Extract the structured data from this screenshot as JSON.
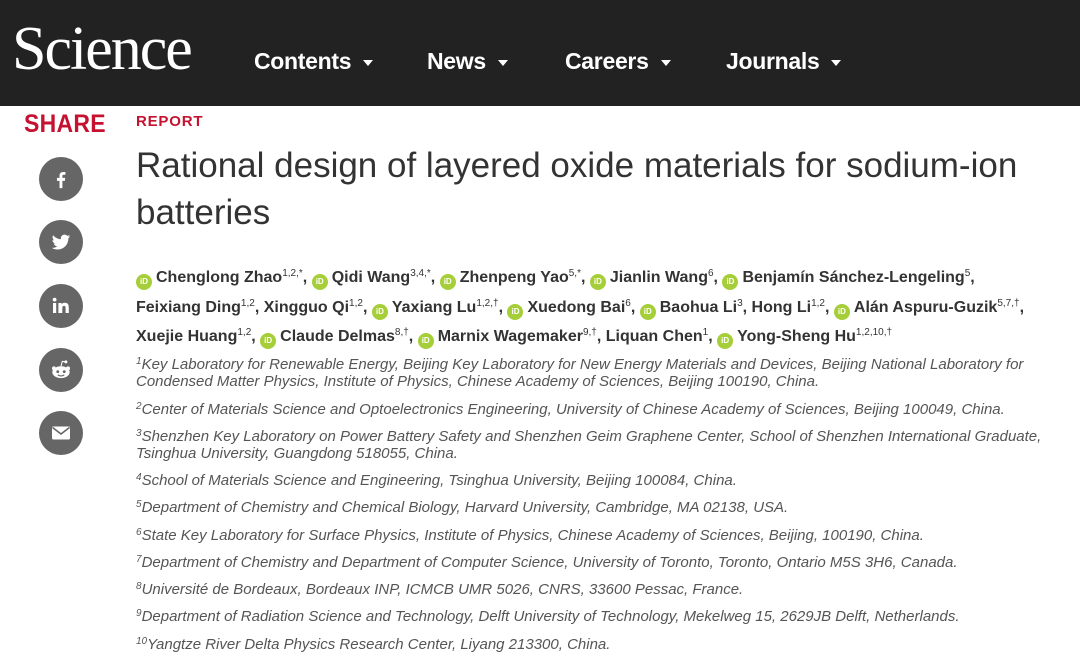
{
  "header": {
    "logo": "Science",
    "nav": [
      {
        "label": "Contents"
      },
      {
        "label": "News"
      },
      {
        "label": "Careers"
      },
      {
        "label": "Journals"
      }
    ]
  },
  "share": {
    "title": "SHARE",
    "buttons": [
      {
        "icon": "facebook-icon"
      },
      {
        "icon": "twitter-icon"
      },
      {
        "icon": "linkedin-icon"
      },
      {
        "icon": "reddit-icon"
      },
      {
        "icon": "email-icon"
      }
    ]
  },
  "article": {
    "type": "REPORT",
    "title": "Rational design of layered oxide materials for sodium-ion batteries",
    "orcid_label": "iD",
    "authors": [
      {
        "name": "Chenglong Zhao",
        "sup": "1,2,*",
        "orcid": true
      },
      {
        "name": "Qidi Wang",
        "sup": "3,4,*",
        "orcid": true
      },
      {
        "name": "Zhenpeng Yao",
        "sup": "5,*",
        "orcid": true
      },
      {
        "name": "Jianlin Wang",
        "sup": "6",
        "orcid": true
      },
      {
        "name": "Benjamín Sánchez-Lengeling",
        "sup": "5",
        "orcid": true
      },
      {
        "name": "Feixiang Ding",
        "sup": "1,2",
        "orcid": false
      },
      {
        "name": "Xingguo Qi",
        "sup": "1,2",
        "orcid": false
      },
      {
        "name": "Yaxiang Lu",
        "sup": "1,2,†",
        "orcid": true
      },
      {
        "name": "Xuedong Bai",
        "sup": "6",
        "orcid": true
      },
      {
        "name": "Baohua Li",
        "sup": "3",
        "orcid": true
      },
      {
        "name": "Hong Li",
        "sup": "1,2",
        "orcid": false
      },
      {
        "name": "Alán Aspuru-Guzik",
        "sup": "5,7,†",
        "orcid": true
      },
      {
        "name": "Xuejie Huang",
        "sup": "1,2",
        "orcid": false
      },
      {
        "name": "Claude Delmas",
        "sup": "8,†",
        "orcid": true
      },
      {
        "name": "Marnix Wagemaker",
        "sup": "9,†",
        "orcid": true
      },
      {
        "name": "Liquan Chen",
        "sup": "1",
        "orcid": false
      },
      {
        "name": "Yong-Sheng Hu",
        "sup": "1,2,10,†",
        "orcid": true
      }
    ],
    "affiliations": [
      {
        "num": "1",
        "text": "Key Laboratory for Renewable Energy, Beijing Key Laboratory for New Energy Materials and Devices, Beijing National Laboratory for Condensed Matter Physics, Institute of Physics, Chinese Academy of Sciences, Beijing 100190, China."
      },
      {
        "num": "2",
        "text": "Center of Materials Science and Optoelectronics Engineering, University of Chinese Academy of Sciences, Beijing 100049, China."
      },
      {
        "num": "3",
        "text": "Shenzhen Key Laboratory on Power Battery Safety and Shenzhen Geim Graphene Center, School of Shenzhen International Graduate, Tsinghua University, Guangdong 518055, China."
      },
      {
        "num": "4",
        "text": "School of Materials Science and Engineering, Tsinghua University, Beijing 100084, China."
      },
      {
        "num": "5",
        "text": "Department of Chemistry and Chemical Biology, Harvard University, Cambridge, MA 02138, USA."
      },
      {
        "num": "6",
        "text": "State Key Laboratory for Surface Physics, Institute of Physics, Chinese Academy of Sciences, Beijing, 100190, China."
      },
      {
        "num": "7",
        "text": "Department of Chemistry and Department of Computer Science, University of Toronto, Toronto, Ontario M5S 3H6, Canada."
      },
      {
        "num": "8",
        "text": "Université de Bordeaux, Bordeaux INP, ICMCB UMR 5026, CNRS, 33600 Pessac, France."
      },
      {
        "num": "9",
        "text": "Department of Radiation Science and Technology, Delft University of Technology, Mekelweg 15, 2629JB Delft, Netherlands."
      },
      {
        "num": "10",
        "text": "Yangtze River Delta Physics Research Center, Liyang 213300, China."
      }
    ]
  },
  "colors": {
    "header_bg": "#222222",
    "accent_red": "#c41230",
    "share_button": "#666666",
    "orcid_green": "#a6ce39"
  }
}
